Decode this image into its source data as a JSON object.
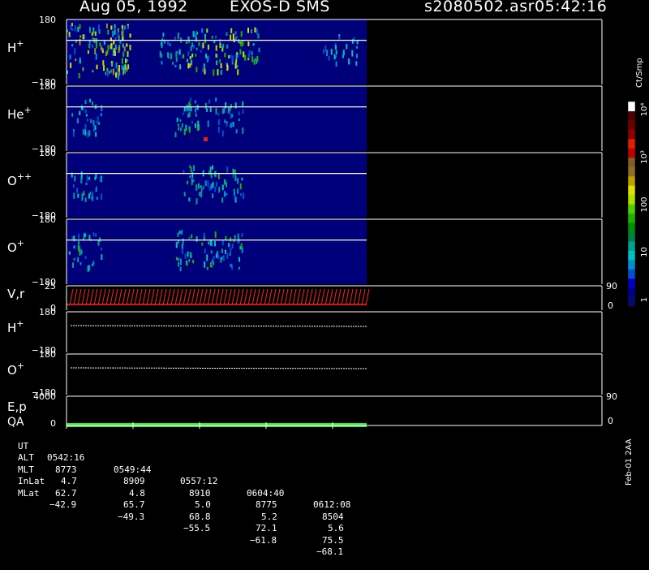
{
  "header": {
    "date": "Aug 05, 1992",
    "instrument": "EXOS-D SMS",
    "file": "s2080502.asr",
    "time": "05:42:16"
  },
  "panels": [
    {
      "label": "H",
      "sup": "+",
      "ytop": "180",
      "ybot": "−180"
    },
    {
      "label": "He",
      "sup": "+",
      "ytop": "180",
      "ybot": "−180"
    },
    {
      "label": "O",
      "sup": "++",
      "ytop": "180",
      "ybot": "−180"
    },
    {
      "label": "O",
      "sup": "+",
      "ytop": "180",
      "ybot": "−180"
    },
    {
      "label": "V,r",
      "sup": "",
      "ytop": "25",
      "ybot": "0",
      "rtop": "90",
      "rbot": "0"
    },
    {
      "label": "H",
      "sup": "+",
      "ytop": "180",
      "ybot": "−180"
    },
    {
      "label": "O",
      "sup": "+",
      "ytop": "180",
      "ybot": "−180"
    },
    {
      "label": "E,p",
      "label2": "QA",
      "sup": "",
      "ytop": "4000",
      "ybot": "0",
      "rtop": "90",
      "rbot": "0"
    }
  ],
  "ephemeris": {
    "labels": [
      "UT",
      "ALT",
      "MLT",
      "InLat",
      "MLat"
    ],
    "rows": [
      [
        "0542:16",
        "0549:44",
        "0557:12",
        "0604:40",
        "0612:08"
      ],
      [
        "8773",
        "8909",
        "8910",
        "8775",
        "8504"
      ],
      [
        "4.7",
        "4.8",
        "5.0",
        "5.2",
        "5.6"
      ],
      [
        "62.7",
        "65.7",
        "68.8",
        "72.1",
        "75.5"
      ],
      [
        "−42.9",
        "−49.3",
        "−55.5",
        "−61.8",
        "−68.1"
      ]
    ]
  },
  "colorbar": {
    "unit": "Ct/Smp",
    "ticks": [
      "1",
      "10",
      "100",
      "10³",
      "10⁴"
    ],
    "colors": [
      "#0a0a6e",
      "#00008c",
      "#0000c8",
      "#0050d0",
      "#0090d0",
      "#00c0c0",
      "#00a090",
      "#008040",
      "#009000",
      "#20b000",
      "#50d000",
      "#b0e000",
      "#e0e000",
      "#c0a000",
      "#907020",
      "#806020",
      "#c00000",
      "#e02000",
      "#900000",
      "#700000",
      "#500000",
      "#ffffff"
    ]
  },
  "footer_note": "Feb-01 2AA",
  "chart_data": {
    "type": "heatmap",
    "x_ticks": [
      "0542:16",
      "0549:44",
      "0557:12",
      "0604:40",
      "0612:08"
    ],
    "pitch_angle_range": [
      -180,
      180
    ],
    "count_scale": "log",
    "count_range": [
      1,
      10000
    ]
  },
  "accent": {
    "plot_bg": "#00007a",
    "trace": "#ff2020",
    "qa_bar": "#40e040"
  }
}
